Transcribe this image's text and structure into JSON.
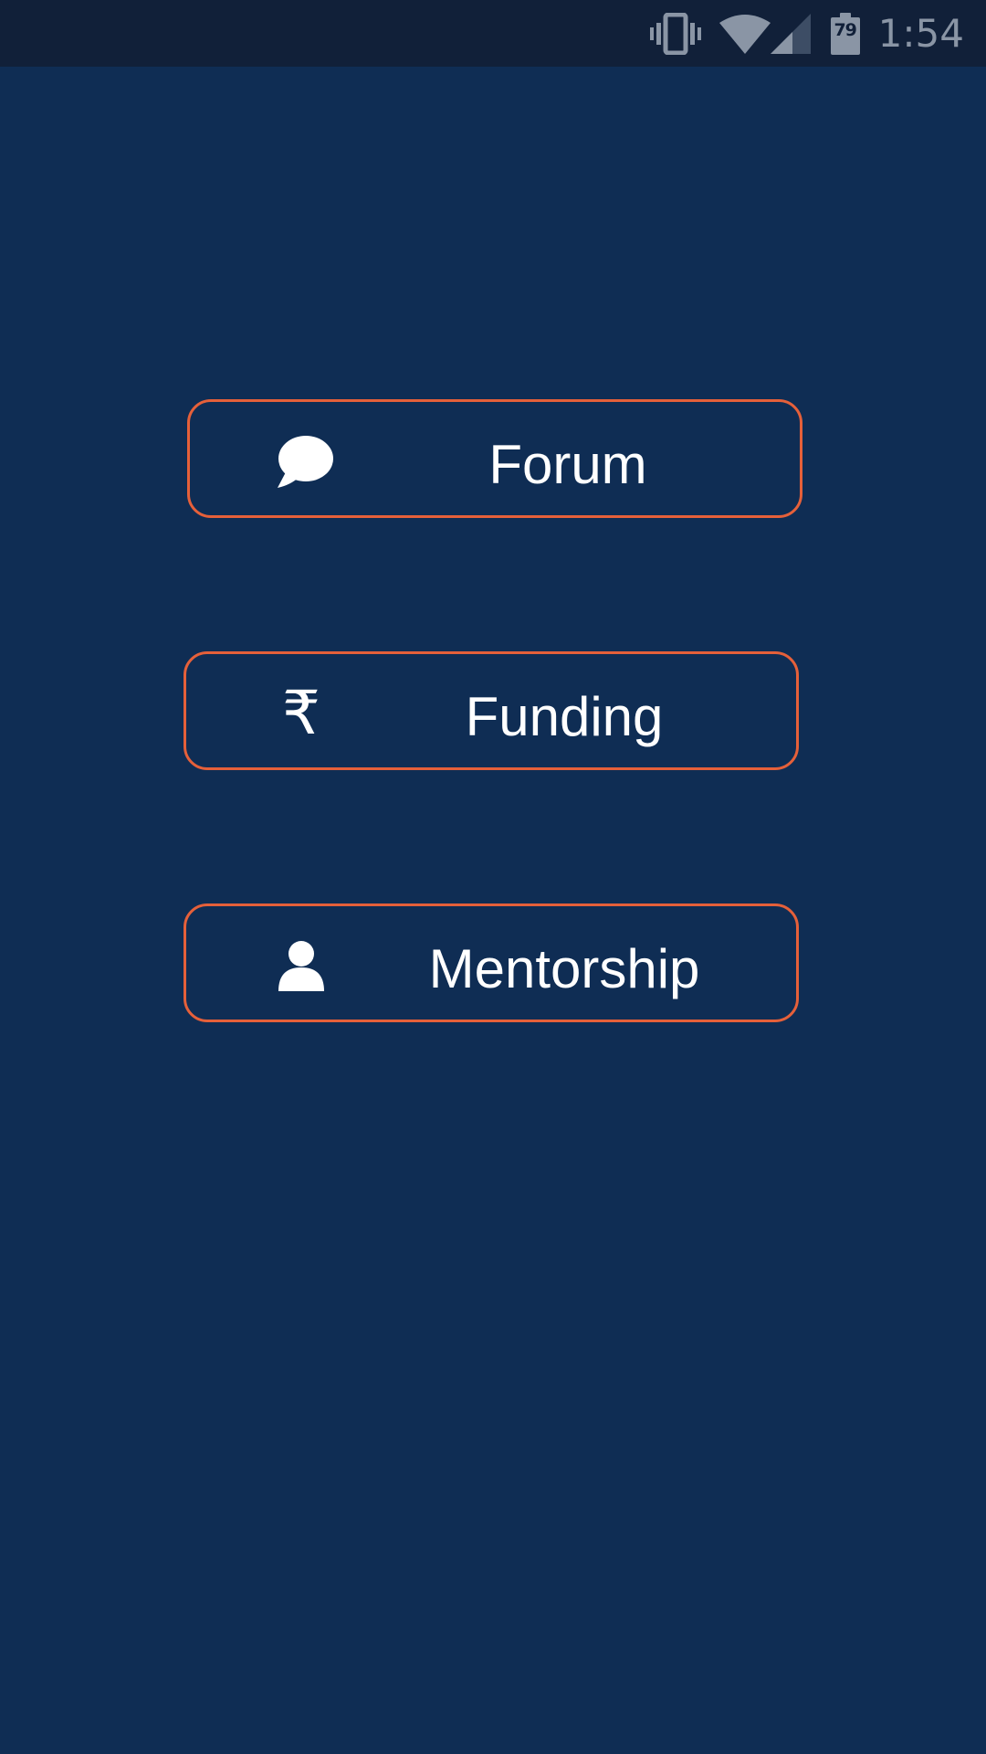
{
  "status_bar": {
    "time": "1:54",
    "battery_level": "79",
    "icons": [
      "vibrate-icon",
      "wifi-icon",
      "signal-icon",
      "battery-icon"
    ]
  },
  "menu": {
    "items": [
      {
        "label": "Forum",
        "icon": "chat-bubble-icon"
      },
      {
        "label": "Funding",
        "icon": "rupee-icon",
        "glyph": "₹"
      },
      {
        "label": "Mentorship",
        "icon": "person-icon"
      }
    ]
  },
  "colors": {
    "background": "#0f2d54",
    "status_bar": "#112039",
    "button_border": "#e5603a",
    "text": "#ffffff"
  }
}
